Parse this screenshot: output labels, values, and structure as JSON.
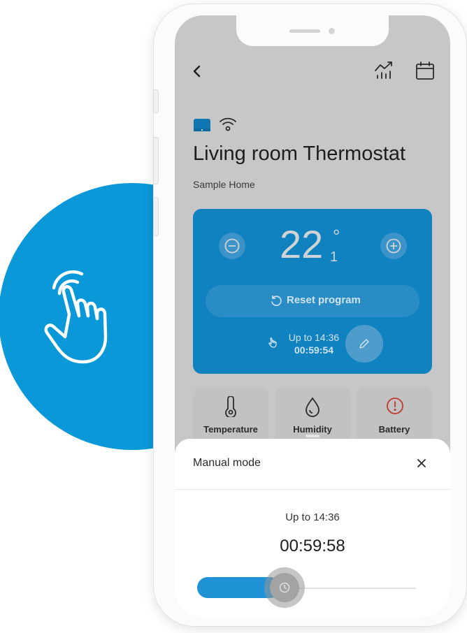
{
  "device": {
    "title": "Living room Thermostat",
    "home": "Sample Home"
  },
  "thermostat": {
    "temperature_whole": "22",
    "temperature_decimal": "1",
    "degree_symbol": "°",
    "reset_label": "Reset program",
    "manual_until": "Up to 14:36",
    "manual_timer": "00:59:54"
  },
  "tiles": [
    {
      "label": "Temperature",
      "icon": "thermometer-icon"
    },
    {
      "label": "Humidity",
      "icon": "droplet-icon"
    },
    {
      "label": "Battery",
      "icon": "alert-icon",
      "color": "#c0392b"
    }
  ],
  "sheet": {
    "title": "Manual mode",
    "until": "Up to 14:36",
    "timer": "00:59:58",
    "slider_level_fraction": 0.38
  },
  "colors": {
    "brand_blue": "#0a98d8",
    "card_blue": "#1082c0",
    "slider_blue": "#1f93d5",
    "alert_red": "#c0392b"
  }
}
